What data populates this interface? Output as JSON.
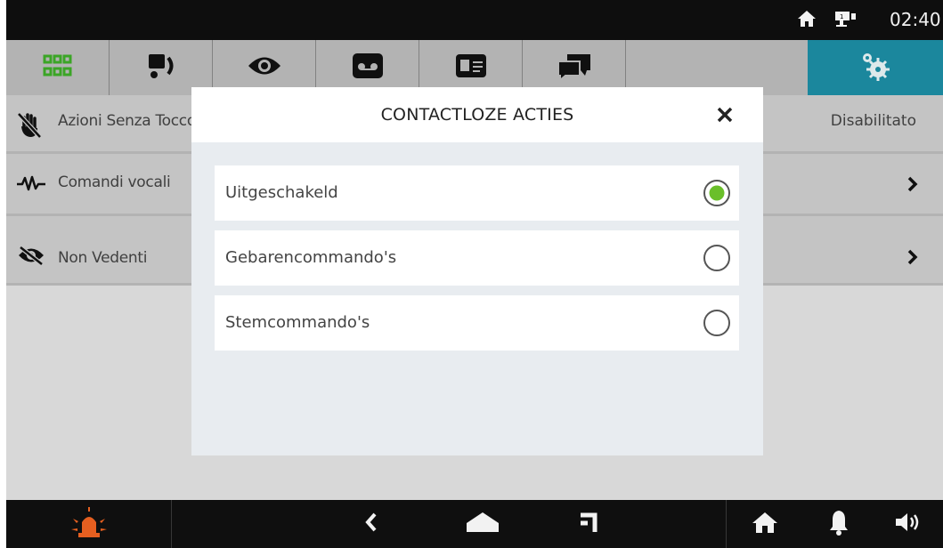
{
  "status_bar": {
    "time": "02:40",
    "icons": [
      "home-icon",
      "intercom-icon"
    ]
  },
  "top_nav": {
    "tabs": [
      {
        "icon": "apps-grid-icon",
        "active": false
      },
      {
        "icon": "door-call-icon",
        "active": false
      },
      {
        "icon": "eye-icon",
        "active": false
      },
      {
        "icon": "voicemail-icon",
        "active": false
      },
      {
        "icon": "contact-card-icon",
        "active": false
      },
      {
        "icon": "chat-icon",
        "active": false
      },
      {
        "icon": "settings-gears-icon",
        "active": true
      }
    ],
    "active_color": "#1d8fa6"
  },
  "settings_list": {
    "rows": [
      {
        "icon": "no-touch-icon",
        "label": "Azioni Senza Tocco",
        "value": "Disabilitato"
      },
      {
        "icon": "voice-wave-icon",
        "label": "Comandi vocali",
        "value": ""
      },
      {
        "icon": "eye-off-icon",
        "label": "Non Vedenti",
        "value": ""
      }
    ]
  },
  "dialog": {
    "title": "CONTACTLOZE ACTIES",
    "close_icon": "close-icon",
    "options": [
      {
        "label": "Uitgeschakeld",
        "selected": true
      },
      {
        "label": "Gebarencommando's",
        "selected": false
      },
      {
        "label": "Stemcommando's",
        "selected": false
      }
    ],
    "selected_color": "#6abf2a"
  },
  "bottom_bar": {
    "icons": [
      "alarm-icon",
      "back-icon",
      "home-nav-icon",
      "recent-apps-icon",
      "house-icon",
      "bell-icon",
      "volume-icon"
    ],
    "alarm_color": "#f26522"
  }
}
